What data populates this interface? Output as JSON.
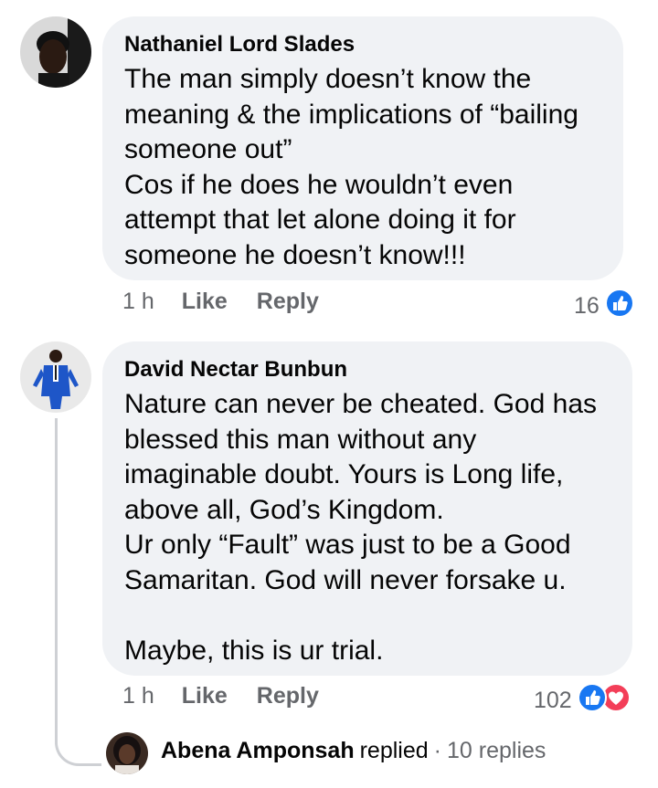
{
  "comments": [
    {
      "author": "Nathaniel Lord Slades",
      "text": "The man simply doesn’t know the\nmeaning & the implications of “bailing\nsomeone out”\nCos if he does he wouldn’t even\nattempt that let alone doing it for\nsomeone he doesn’t know!!!",
      "time": "1 h",
      "like_label": "Like",
      "reply_label": "Reply",
      "reaction_count": "16",
      "reactions": [
        "like-icon"
      ]
    },
    {
      "author": "David Nectar Bunbun",
      "text": "Nature can never be cheated. God has\nblessed this man without any\nimaginable doubt. Yours is Long life,\nabove all, God’s Kingdom.\nUr only “Fault” was just to be a Good\nSamaritan. God will never forsake u.\n\nMaybe, this is ur trial.",
      "time": "1 h",
      "like_label": "Like",
      "reply_label": "Reply",
      "reaction_count": "102",
      "reactions": [
        "like-icon",
        "love-icon"
      ]
    }
  ],
  "reply_summary": {
    "name": "Abena Amponsah",
    "verb": "replied",
    "separator": "·",
    "count": "10 replies"
  },
  "colors": {
    "bubble": "#f0f2f5",
    "meta": "#65676b",
    "like_blue": "#1877f2",
    "love_red": "#f33e58"
  }
}
